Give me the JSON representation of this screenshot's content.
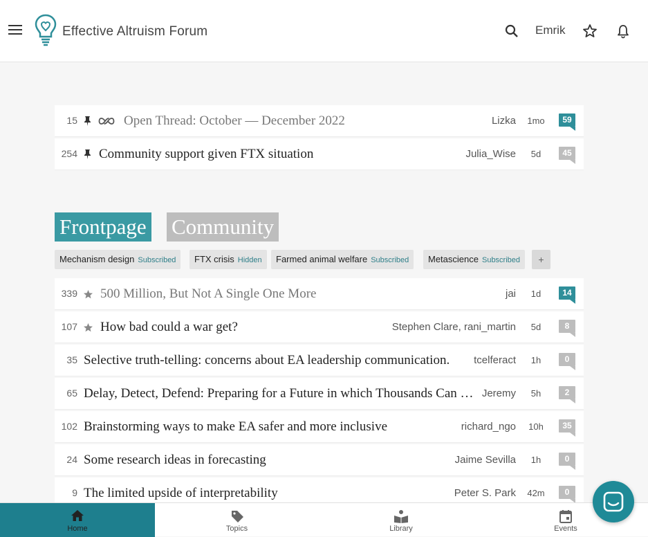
{
  "header": {
    "site_title": "Effective Altruism Forum",
    "username": "Emrik"
  },
  "pinned": [
    {
      "karma": "15",
      "title": "Open Thread: October — December 2022",
      "author": "Lizka",
      "age": "1mo",
      "comments": "59"
    },
    {
      "karma": "254",
      "title": "Community support given FTX situation",
      "author": "Julia_Wise",
      "age": "5d",
      "comments": "45"
    }
  ],
  "tabs": {
    "frontpage": "Frontpage",
    "community": "Community"
  },
  "tags": [
    {
      "name": "Mechanism design",
      "status": "Subscribed"
    },
    {
      "name": "FTX crisis",
      "status": "Hidden"
    },
    {
      "name": "Farmed animal welfare",
      "status": "Subscribed"
    },
    {
      "name": "Metascience",
      "status": "Subscribed"
    }
  ],
  "tag_add": "+",
  "posts": [
    {
      "karma": "339",
      "title": "500 Million, But Not A Single One More",
      "author": "jai",
      "age": "1d",
      "comments": "14"
    },
    {
      "karma": "107",
      "title": "How bad could a war get?",
      "author": "Stephen Clare, rani_martin",
      "age": "5d",
      "comments": "8"
    },
    {
      "karma": "35",
      "title": "Selective truth-telling: concerns about EA leadership communication.",
      "author": "tcelferact",
      "age": "1h",
      "comments": "0"
    },
    {
      "karma": "65",
      "title": "Delay, Detect, Defend: Preparing for a Future in which Thousands Can Release New Pandemics",
      "author": "Jeremy",
      "age": "5h",
      "comments": "2"
    },
    {
      "karma": "102",
      "title": "Brainstorming ways to make EA safer and more inclusive",
      "author": "richard_ngo",
      "age": "10h",
      "comments": "35"
    },
    {
      "karma": "24",
      "title": "Some research ideas in forecasting",
      "author": "Jaime Sevilla",
      "age": "1h",
      "comments": "0"
    },
    {
      "karma": "9",
      "title": "The limited upside of interpretability",
      "author": "Peter S. Park",
      "age": "42m",
      "comments": "0"
    }
  ],
  "bottom_nav": [
    {
      "label": "Home"
    },
    {
      "label": "Topics"
    },
    {
      "label": "Library"
    },
    {
      "label": "Events"
    }
  ],
  "colors": {
    "accent": "#3a9aa3",
    "nav_active": "#1e7f8e",
    "comment_teal": "#2f8f9a",
    "comment_grey": "#bdbdbd"
  }
}
